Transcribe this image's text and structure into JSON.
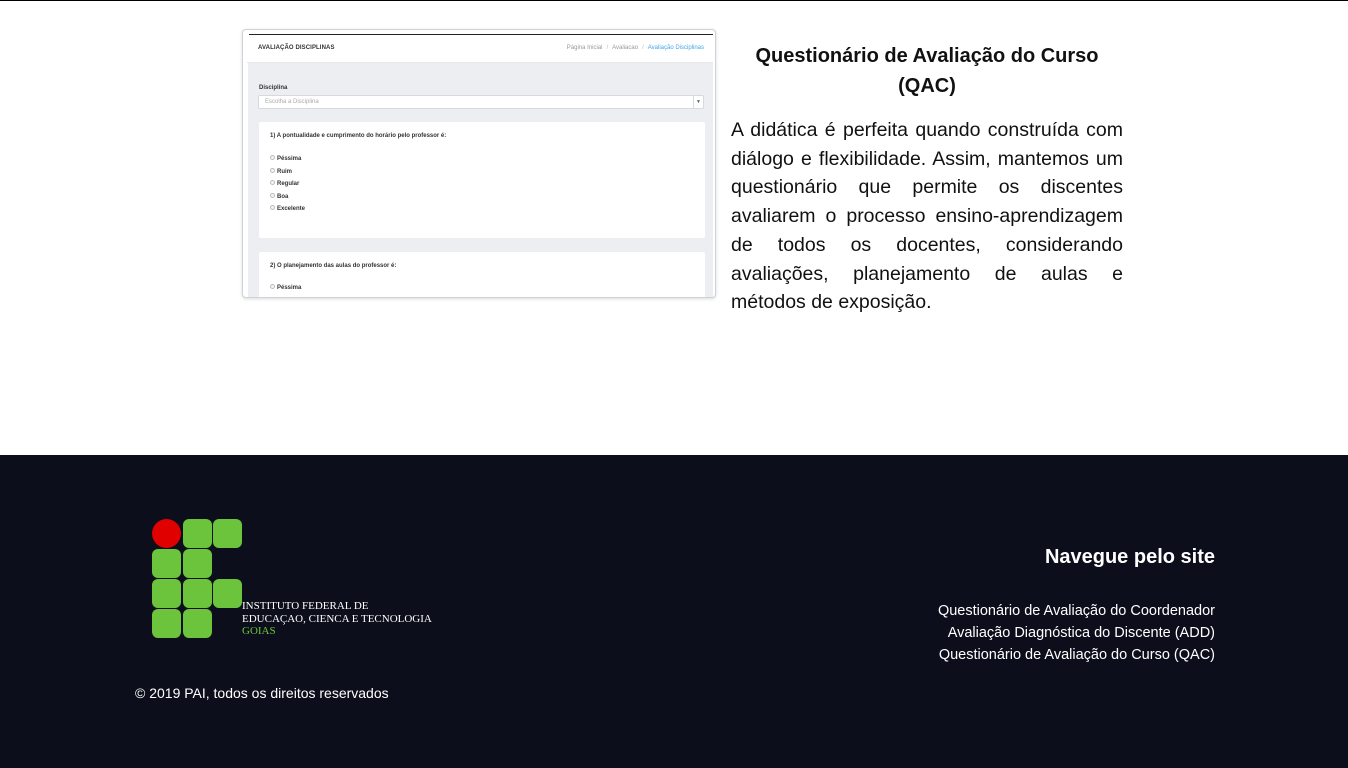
{
  "screenshot": {
    "title": "AVALIAÇÃO DISCIPLINAS",
    "breadcrumb": [
      "Página Inicial",
      "Avaliacao",
      "Avaliação Disciplinas"
    ],
    "discipline_label": "Disciplina",
    "discipline_placeholder": "Escolha a Disciplina",
    "question1": "1) A pontualidade e cumprimento do horário pelo professor é:",
    "question2": "2) O planejamento das aulas do professor é:",
    "options": [
      "Péssima",
      "Ruim",
      "Regular",
      "Boa",
      "Excelente"
    ]
  },
  "info": {
    "title": "Questionário de Avaliação do Curso (QAC)",
    "text": "A didática é perfeita quando construída com diálogo e flexibilidade. Assim, mantemos um questionário que permite os discentes avaliarem o processo ensino-aprendizagem de todos os docentes, considerando avaliações, planejamento de aulas e métodos de exposição."
  },
  "footer": {
    "logo_lines": [
      "INSTITUTO FEDERAL DE",
      "EDUCAÇAO, CIENCA E TECNOLOGIA",
      "GOIAS"
    ],
    "copyright": "© 2019 PAI, todos os direitos reservados",
    "nav_title": "Navegue pelo site",
    "nav_links": [
      "Questionário de Avaliação do Coordenador",
      "Avaliação Diagnóstica do Discente (ADD)",
      "Questionário de Avaliação do Curso (QAC)"
    ]
  },
  "colors": {
    "footer_bg": "#0c0f1b",
    "logo_green": "#6cc43c",
    "logo_red": "#e00000",
    "breadcrumb_active": "#45a6e8"
  }
}
